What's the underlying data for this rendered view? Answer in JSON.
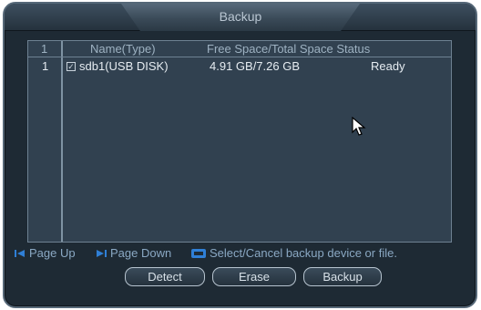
{
  "dialog": {
    "title": "Backup"
  },
  "table": {
    "headers": {
      "index": "1",
      "name": "Name(Type)",
      "space": "Free Space/Total Space Status"
    },
    "rows": [
      {
        "index": "1",
        "checked": true,
        "name": "sdb1(USB DISK)",
        "space": "4.91 GB/7.26 GB",
        "status": "Ready"
      }
    ]
  },
  "hints": {
    "page_up": "Page Up",
    "page_down": "Page Down",
    "select": "Select/Cancel backup device or file."
  },
  "buttons": {
    "detect": "Detect",
    "erase": "Erase",
    "backup": "Backup"
  },
  "colors": {
    "background": "#1e2a34",
    "panel": "#314150",
    "hint_text": "#8aa8c3",
    "hint_icon": "#2f7fd6"
  },
  "icons": {
    "page_up": "page-up-icon",
    "page_down": "page-down-icon",
    "function": "fn-key-icon",
    "pointer": "mouse-pointer-icon"
  }
}
